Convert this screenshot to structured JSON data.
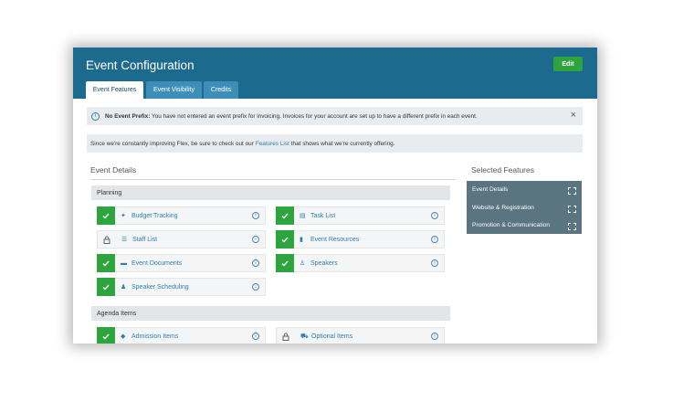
{
  "header": {
    "title": "Event Configuration",
    "edit_label": "Edit"
  },
  "tabs": [
    {
      "label": "Event Features",
      "active": true
    },
    {
      "label": "Event Visibility",
      "active": false
    },
    {
      "label": "Credits",
      "active": false
    }
  ],
  "notice": {
    "bold": "No Event Prefix:",
    "text": " You have not entered an event prefix for invoicing. Invoices for your account are set up to have a different prefix in each event.",
    "close_icon": "×"
  },
  "info_bar": {
    "before": "Since we're constantly improving Flex, be sure to check out our ",
    "link": "Features List",
    "after": " that shows what we're currently offering."
  },
  "event_details": {
    "title": "Event Details",
    "groups": [
      {
        "name": "Planning",
        "features": [
          {
            "label": "Budget Tracking",
            "enabled": true,
            "icon": "budget-icon"
          },
          {
            "label": "Task List",
            "enabled": true,
            "icon": "task-icon"
          },
          {
            "label": "Staff List",
            "enabled": false,
            "icon": "staff-icon"
          },
          {
            "label": "Event Resources",
            "enabled": true,
            "icon": "resources-icon"
          },
          {
            "label": "Event Documents",
            "enabled": true,
            "icon": "documents-icon"
          },
          {
            "label": "Speakers",
            "enabled": true,
            "icon": "speakers-icon"
          },
          {
            "label": "Speaker Scheduling",
            "enabled": true,
            "icon": "speaker-scheduling-icon"
          }
        ]
      },
      {
        "name": "Agenda Items",
        "features": [
          {
            "label": "Admission Items",
            "enabled": true,
            "icon": "admission-icon"
          },
          {
            "label": "Optional Items",
            "enabled": false,
            "icon": "optional-items-icon"
          }
        ]
      }
    ]
  },
  "selected_features": {
    "title": "Selected Features",
    "items": [
      "Event Details",
      "Website & Registration",
      "Promotion & Communication"
    ]
  },
  "colors": {
    "header": "#1d6a8f",
    "tab": "#3e8fb8",
    "check": "#2da43d",
    "link": "#2f7fb1",
    "selected_panel": "#5a7480"
  }
}
